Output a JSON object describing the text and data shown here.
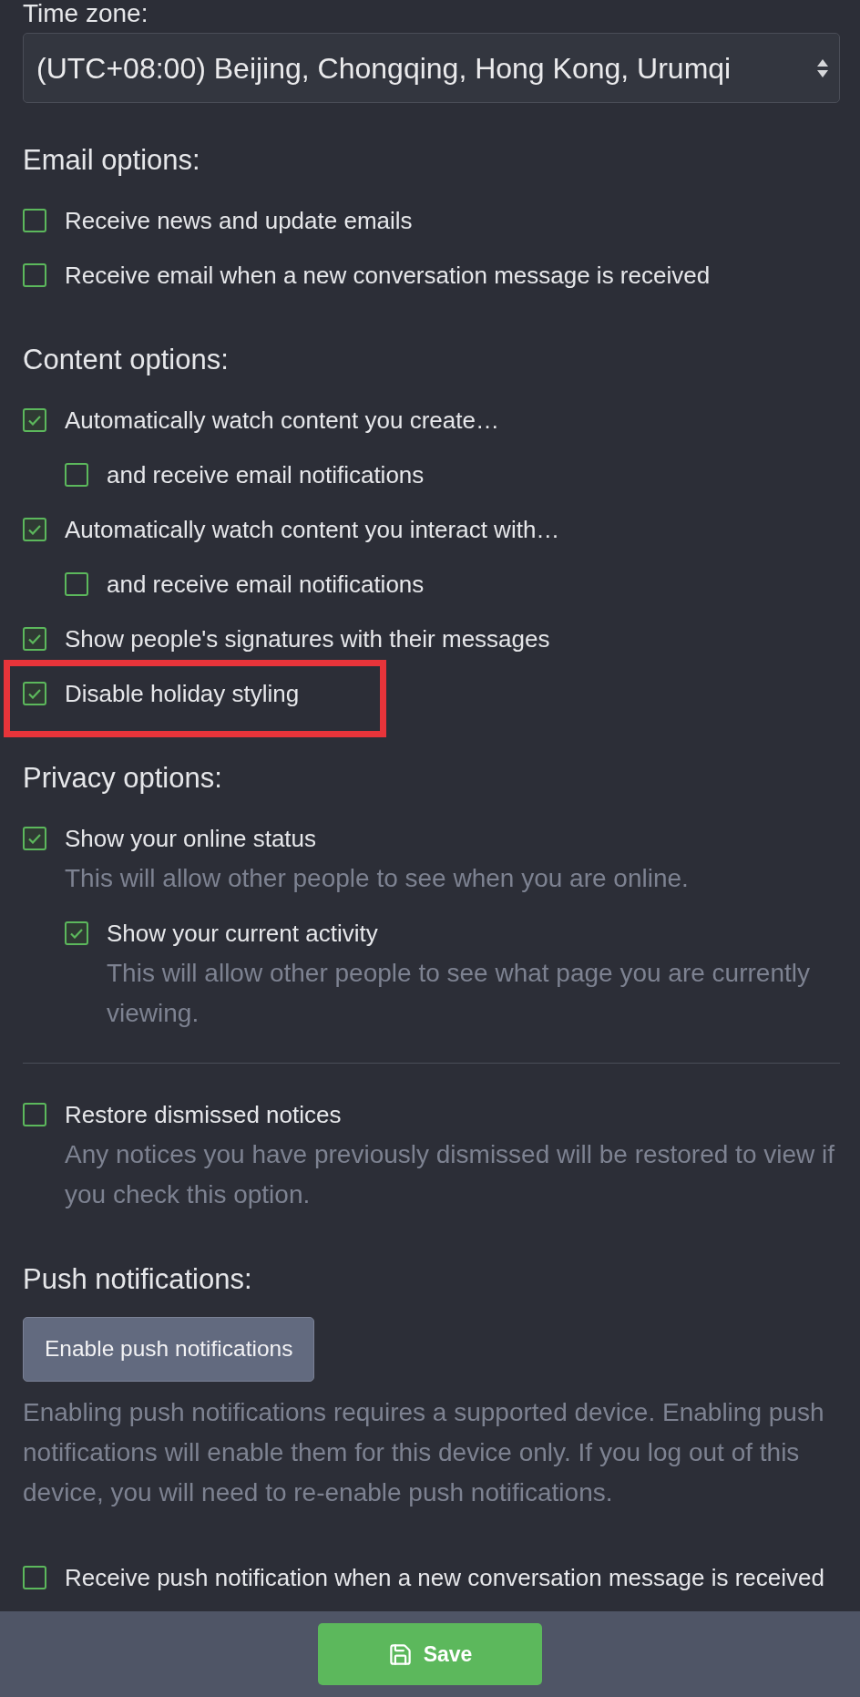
{
  "timezone": {
    "label": "Time zone:",
    "value": "(UTC+08:00) Beijing, Chongqing, Hong Kong, Urumqi"
  },
  "sections": [
    {
      "kind": "options",
      "heading": "Email options:",
      "options": [
        {
          "label": "Receive news and update emails",
          "checked": false,
          "highlighted": false
        },
        {
          "label": "Receive email when a new conversation message is received",
          "checked": false,
          "highlighted": false
        }
      ]
    },
    {
      "kind": "options",
      "heading": "Content options:",
      "options": [
        {
          "label": "Automatically watch content you create…",
          "checked": true,
          "highlighted": false,
          "children": [
            {
              "label": "and receive email notifications",
              "checked": false,
              "highlighted": false
            }
          ]
        },
        {
          "label": "Automatically watch content you interact with…",
          "checked": true,
          "highlighted": false,
          "children": [
            {
              "label": "and receive email notifications",
              "checked": false,
              "highlighted": false
            }
          ]
        },
        {
          "label": "Show people's signatures with their messages",
          "checked": true,
          "highlighted": false
        },
        {
          "label": "Disable holiday styling",
          "checked": true,
          "highlighted": true
        }
      ]
    },
    {
      "kind": "options",
      "heading": "Privacy options:",
      "options": [
        {
          "label": "Show your online status",
          "checked": true,
          "highlighted": false,
          "description": "This will allow other people to see when you are online.",
          "children": [
            {
              "label": "Show your current activity",
              "checked": true,
              "highlighted": false,
              "description": "This will allow other people to see what page you are currently viewing."
            }
          ]
        }
      ]
    },
    {
      "kind": "divider"
    },
    {
      "kind": "options",
      "options": [
        {
          "label": "Restore dismissed notices",
          "checked": false,
          "highlighted": false,
          "description": "Any notices you have previously dismissed will be restored to view if you check this option."
        }
      ]
    },
    {
      "kind": "push",
      "heading": "Push notifications:",
      "button": "Enable push notifications",
      "note": "Enabling push notifications requires a supported device. Enabling push notifications will enable them for this device only. If you log out of this device, you will need to re-enable push notifications.",
      "options": [
        {
          "label": "Receive push notification when a new conversation message is received",
          "checked": false,
          "highlighted": false
        }
      ]
    }
  ],
  "footer": {
    "save_button": "Save"
  }
}
